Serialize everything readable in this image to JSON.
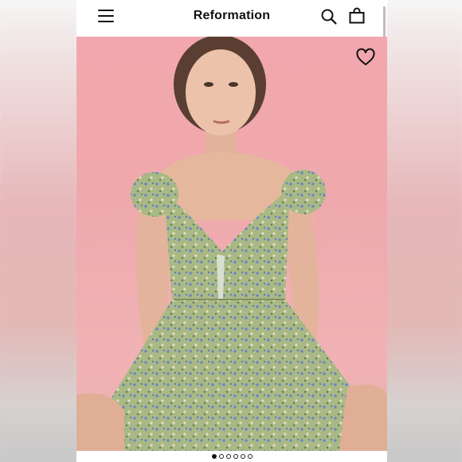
{
  "app": {
    "brand": "Reformation"
  },
  "header": {
    "menu_icon": "hamburger-menu-icon",
    "search_icon": "search-icon",
    "bag_icon": "shopping-bag-icon"
  },
  "product": {
    "image_description_icon": "product-photo",
    "wishlist_icon": "heart-outline-icon",
    "image_count": 6,
    "active_image": 1
  },
  "colors": {
    "background_pink": "#f1a7ad",
    "dress_green": "#9fb27a",
    "text": "#111111"
  }
}
